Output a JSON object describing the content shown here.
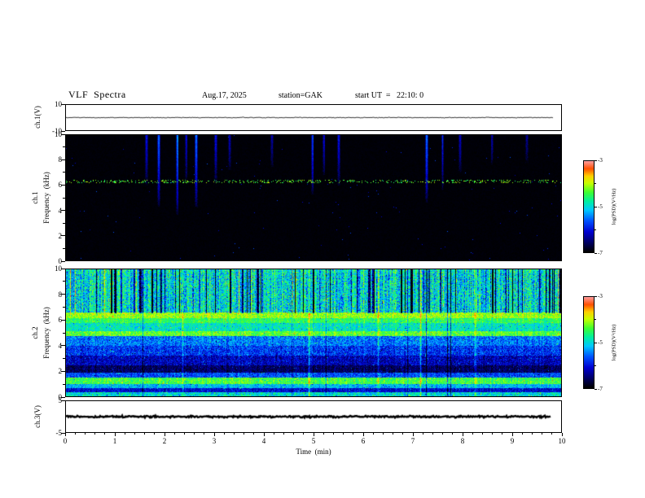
{
  "figure": {
    "title": "VLF  Spectra",
    "date": "Aug.17, 2025",
    "station": "station=GAK",
    "start_ut": "start UT  =   22:10: 0"
  },
  "x_axis": {
    "label": "Time  (min)",
    "min": 0,
    "max": 10,
    "major_ticks": [
      0,
      1,
      2,
      3,
      4,
      5,
      6,
      7,
      8,
      9,
      10
    ],
    "minor_per_major": 5
  },
  "colorbar": {
    "label": "log(PSD)(V²/Hz)",
    "min": -7,
    "max": -3,
    "labeled_ticks": [
      -3,
      -5,
      -7
    ],
    "minor_ticks": [
      -4,
      -6
    ],
    "colormap": [
      {
        "t": 0.0,
        "c": "#000000"
      },
      {
        "t": 0.1,
        "c": "#000060"
      },
      {
        "t": 0.22,
        "c": "#0000d0"
      },
      {
        "t": 0.34,
        "c": "#0050ff"
      },
      {
        "t": 0.46,
        "c": "#00c8ff"
      },
      {
        "t": 0.56,
        "c": "#00f0a0"
      },
      {
        "t": 0.66,
        "c": "#40ff30"
      },
      {
        "t": 0.76,
        "c": "#c8ff00"
      },
      {
        "t": 0.84,
        "c": "#ffd000"
      },
      {
        "t": 0.92,
        "c": "#ff5000"
      },
      {
        "t": 1.0,
        "c": "#ff9898"
      }
    ]
  },
  "panels": {
    "ch1v": {
      "ylabel": "ch.1(V)",
      "ymin": -10,
      "ymax": 10,
      "yticks": [
        10,
        -10
      ]
    },
    "ch1spec": {
      "ylabel_channel": "ch.1",
      "ylabel_axis": "Frequency  (kHz)",
      "ymin": 0,
      "ymax": 10,
      "yticks": [
        0,
        2,
        4,
        6,
        8,
        10
      ],
      "yminor": [
        1,
        3,
        5,
        7,
        9
      ]
    },
    "ch2spec": {
      "ylabel_channel": "ch.2",
      "ylabel_axis": "Frequency  (kHz)",
      "ymin": 0,
      "ymax": 10,
      "yticks": [
        0,
        2,
        4,
        6,
        8,
        10
      ],
      "yminor": [
        1,
        3,
        5,
        7,
        9
      ]
    },
    "ch3v": {
      "ylabel": "ch.3(V)",
      "ymin": -5,
      "ymax": 5,
      "yticks": [
        5,
        -5
      ]
    }
  },
  "chart_data": [
    {
      "type": "line",
      "panel": "ch1v",
      "description": "ch.1 voltage trace, flat noisy line at 0 V",
      "xlabel": "Time (min)",
      "ylabel": "ch.1(V)",
      "x_range": [
        0,
        9.85
      ],
      "y_range": [
        -10,
        10
      ],
      "baseline": 0,
      "noise_amplitude": 0.35,
      "line_width": 0.8,
      "seed": 7
    },
    {
      "type": "heatmap",
      "panel": "ch1spec",
      "description": "ch.1 VLF spectrogram, mostly at noise floor (-7) with sparse sferic vertical streaks and a faint band near 6.3 kHz",
      "xlabel": "Time (min)",
      "ylabel": "Frequency (kHz)",
      "x_range": [
        0,
        10
      ],
      "y_range": [
        0,
        10
      ],
      "value_range": [
        -7,
        -3
      ],
      "background_value": -7,
      "bands": [
        {
          "fmin": 6.2,
          "fmax": 6.45,
          "value": -4.3,
          "sparse": 0.2
        }
      ],
      "streaks": [
        {
          "t": 1.62,
          "fmin": 6.0,
          "strength": 1.0
        },
        {
          "t": 1.87,
          "fmin": 4.3,
          "strength": 1.45
        },
        {
          "t": 2.24,
          "fmin": 3.6,
          "strength": 1.6
        },
        {
          "t": 2.42,
          "fmin": 6.4,
          "strength": 0.9
        },
        {
          "t": 2.62,
          "fmin": 4.2,
          "strength": 1.5
        },
        {
          "t": 3.02,
          "fmin": 6.2,
          "strength": 1.0
        },
        {
          "t": 3.3,
          "fmin": 7.2,
          "strength": 0.75
        },
        {
          "t": 4.15,
          "fmin": 7.5,
          "strength": 0.7
        },
        {
          "t": 4.97,
          "fmin": 5.2,
          "strength": 1.25
        },
        {
          "t": 5.2,
          "fmin": 6.8,
          "strength": 0.9
        },
        {
          "t": 5.5,
          "fmin": 6.0,
          "strength": 1.0
        },
        {
          "t": 7.28,
          "fmin": 4.6,
          "strength": 1.5
        },
        {
          "t": 7.6,
          "fmin": 5.6,
          "strength": 1.2
        },
        {
          "t": 7.95,
          "fmin": 7.0,
          "strength": 0.8
        },
        {
          "t": 8.6,
          "fmin": 7.6,
          "strength": 0.7
        },
        {
          "t": 9.3,
          "fmin": 7.8,
          "strength": 0.6
        }
      ],
      "seed": 3
    },
    {
      "type": "heatmap",
      "panel": "ch2spec",
      "description": "ch.2 VLF spectrogram, broadband noise: green/cyan above 6.6 kHz with dark vertical streaks, bright bands near 6.3, 4.9 and 1.2 kHz, dark blue below 4 kHz",
      "xlabel": "Time (min)",
      "ylabel": "Frequency (kHz)",
      "x_range": [
        0,
        10
      ],
      "y_range": [
        0,
        10
      ],
      "value_range": [
        -7,
        -3
      ],
      "bands": [
        {
          "fmin": 9.7,
          "fmax": 10.01,
          "value": -4.9,
          "noise": 0.5
        },
        {
          "fmin": 6.6,
          "fmax": 9.7,
          "value": -5.0,
          "noise": 0.55
        },
        {
          "fmin": 6.15,
          "fmax": 6.6,
          "value": -4.1,
          "noise": 0.3
        },
        {
          "fmin": 5.8,
          "fmax": 6.15,
          "value": -4.5,
          "noise": 0.3
        },
        {
          "fmin": 5.15,
          "fmax": 5.8,
          "value": -4.9,
          "noise": 0.35
        },
        {
          "fmin": 4.75,
          "fmax": 5.15,
          "value": -4.3,
          "noise": 0.3
        },
        {
          "fmin": 4.0,
          "fmax": 4.75,
          "value": -5.5,
          "noise": 0.4
        },
        {
          "fmin": 3.2,
          "fmax": 4.0,
          "value": -5.8,
          "noise": 0.4
        },
        {
          "fmin": 2.4,
          "fmax": 3.2,
          "value": -6.2,
          "noise": 0.35
        },
        {
          "fmin": 1.85,
          "fmax": 2.4,
          "value": -6.6,
          "noise": 0.25
        },
        {
          "fmin": 1.45,
          "fmax": 1.85,
          "value": -5.7,
          "noise": 0.35
        },
        {
          "fmin": 0.95,
          "fmax": 1.45,
          "value": -4.4,
          "noise": 0.3
        },
        {
          "fmin": 0.6,
          "fmax": 0.95,
          "value": -5.2,
          "noise": 0.35
        },
        {
          "fmin": 0.3,
          "fmax": 0.6,
          "value": -6.1,
          "noise": 0.3
        },
        {
          "fmin": 0.0,
          "fmax": 0.3,
          "value": -5.0,
          "noise": 0.45
        }
      ],
      "bright_streaks": [
        {
          "t": 2.35,
          "amp": 0.5
        },
        {
          "t": 4.9,
          "amp": 0.9
        },
        {
          "t": 6.3,
          "amp": 0.45
        },
        {
          "t": 7.15,
          "amp": 0.85
        },
        {
          "t": 8.25,
          "amp": 0.5
        }
      ],
      "dark_streak_count": 85,
      "upper_bright_count": 35,
      "seed": 11
    },
    {
      "type": "line",
      "panel": "ch3v",
      "description": "ch.3 voltage trace, thick flat black line at 0 V",
      "xlabel": "Time (min)",
      "ylabel": "ch.3(V)",
      "x_range": [
        0,
        9.8
      ],
      "y_range": [
        -5,
        5
      ],
      "baseline": 0,
      "noise_amplitude": 0.3,
      "line_width": 2.4,
      "seed": 9
    }
  ]
}
